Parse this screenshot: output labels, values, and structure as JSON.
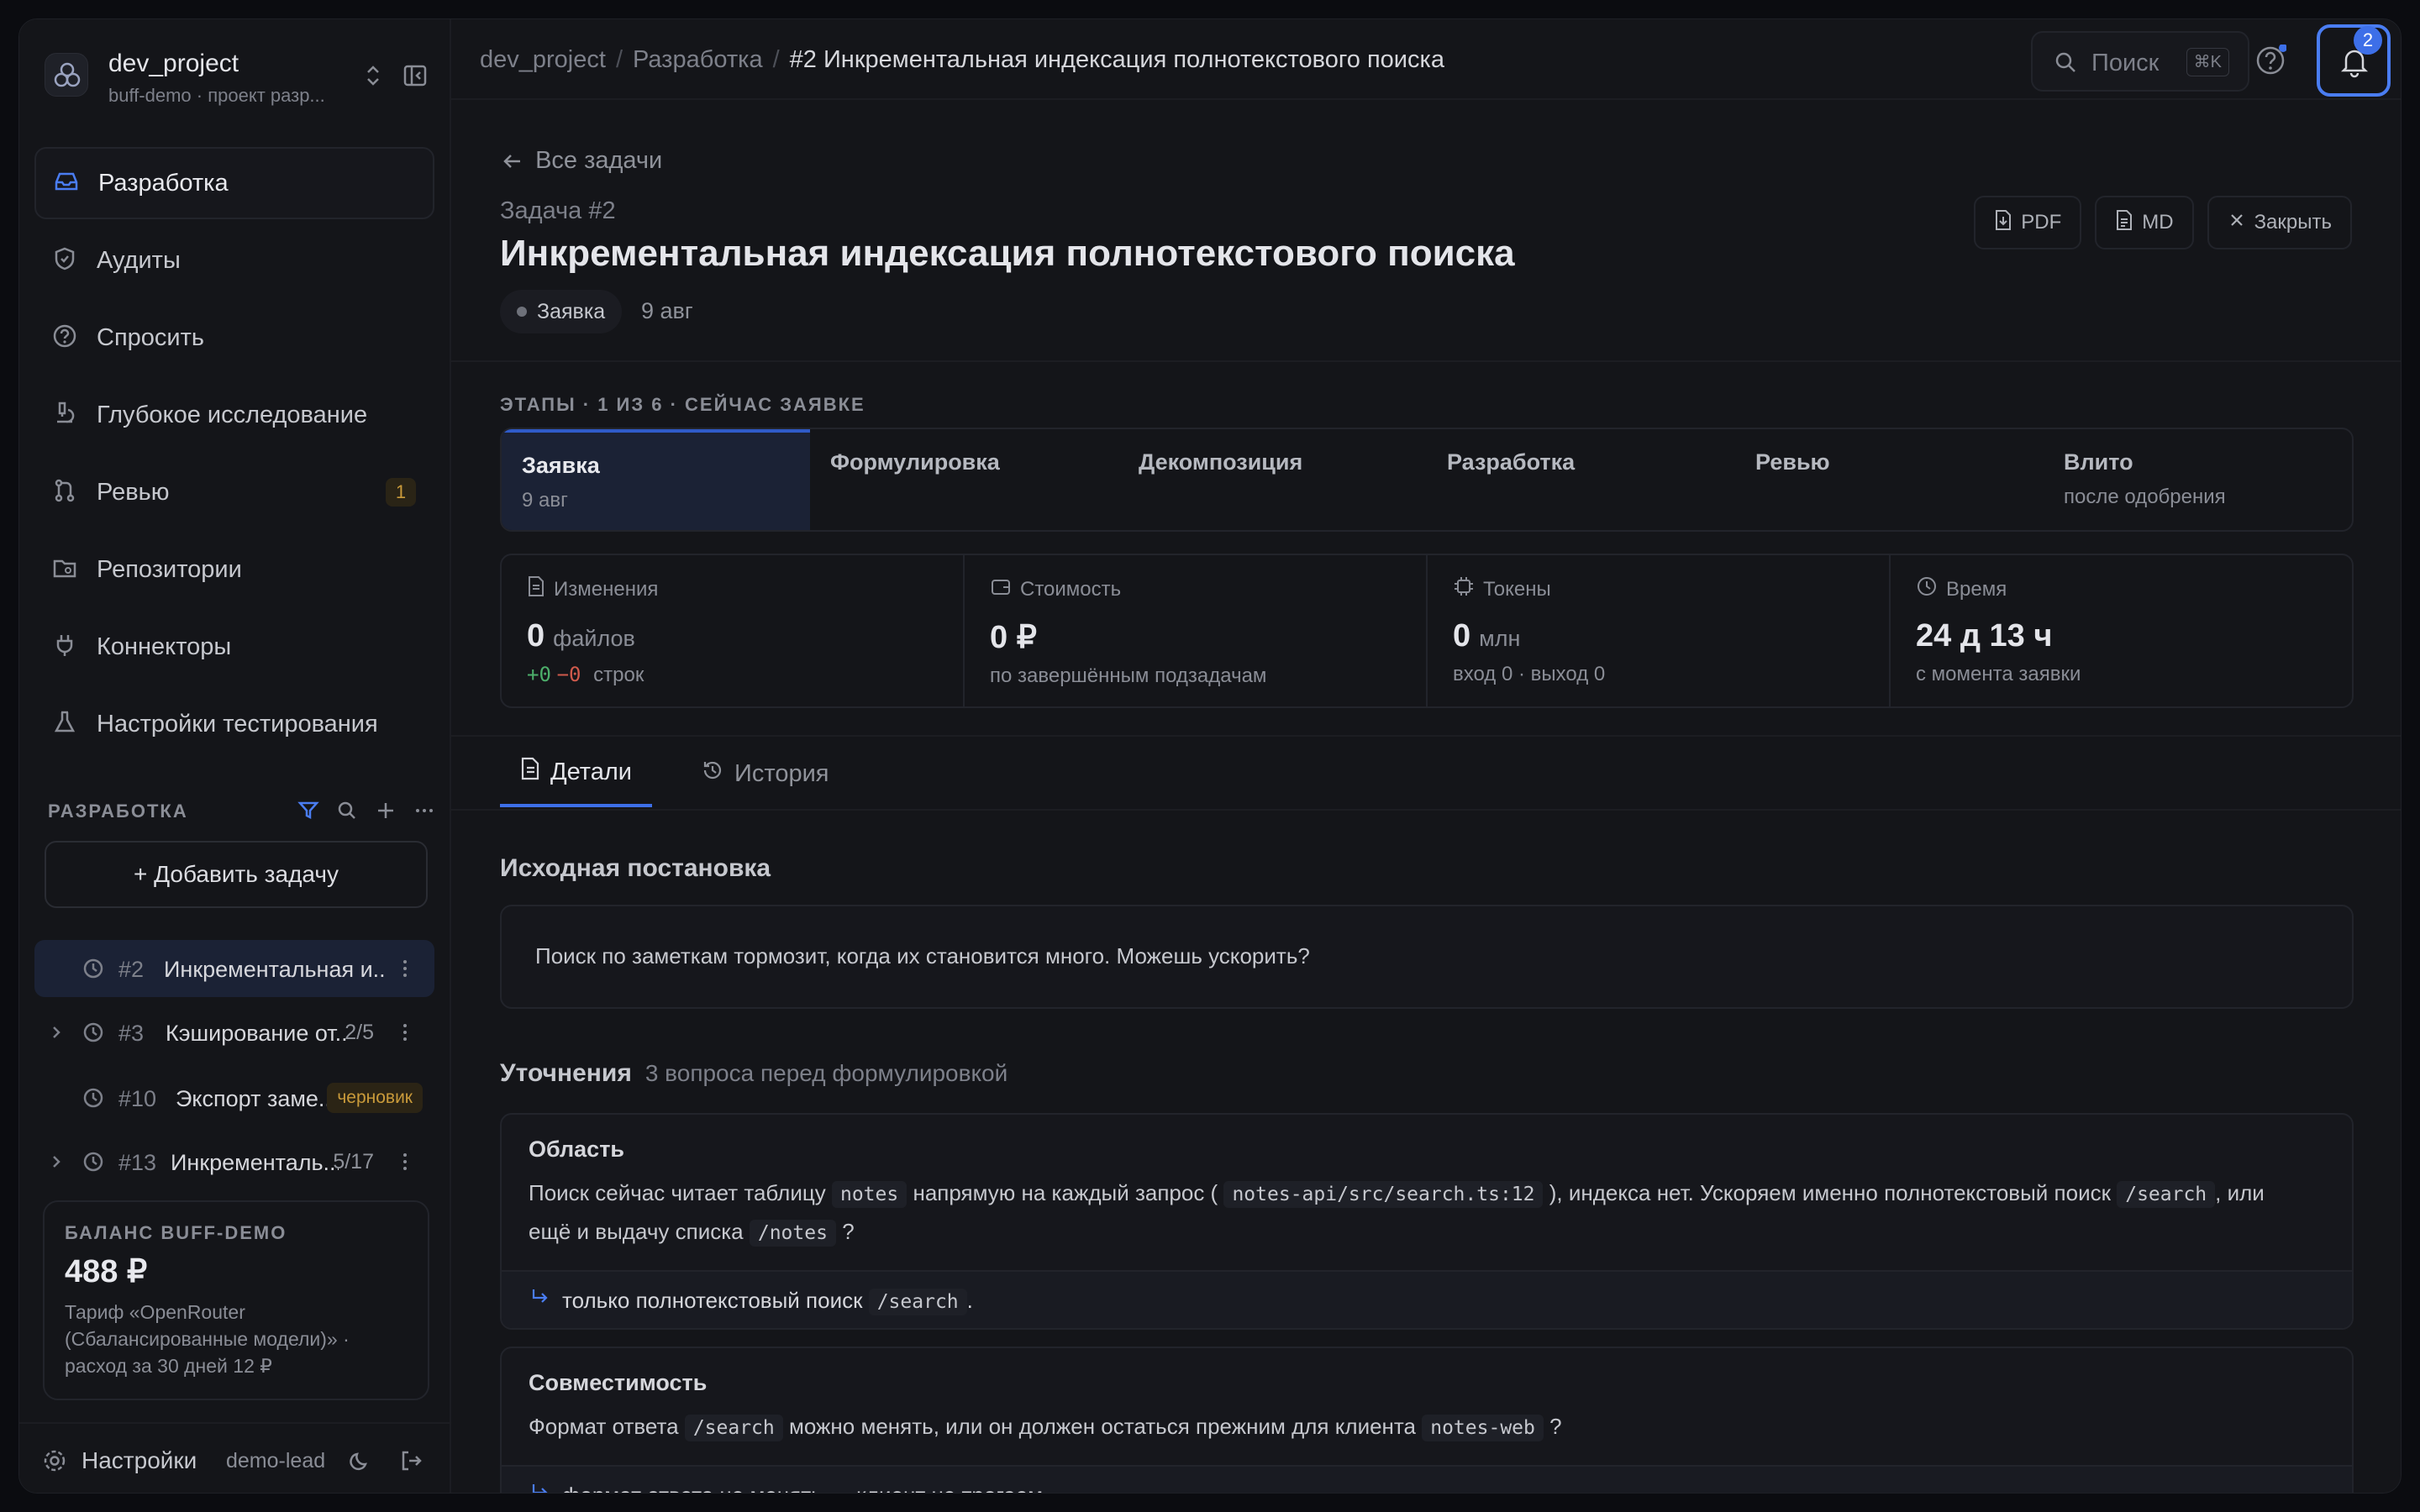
{
  "sidebar": {
    "project_name": "dev_project",
    "project_sub": "buff-demo · проект разр...",
    "nav": [
      {
        "label": "Разработка",
        "icon": "inbox-icon"
      },
      {
        "label": "Аудиты",
        "icon": "shield-icon"
      },
      {
        "label": "Спросить",
        "icon": "question-icon"
      },
      {
        "label": "Глубокое исследование",
        "icon": "flask-search-icon"
      },
      {
        "label": "Ревью",
        "icon": "git-merge-icon",
        "badge": "1"
      },
      {
        "label": "Репозитории",
        "icon": "folder-git-icon"
      },
      {
        "label": "Коннекторы",
        "icon": "plug-icon"
      },
      {
        "label": "Настройки тестирования",
        "icon": "beaker-icon"
      }
    ],
    "section_title": "РАЗРАБОТКА",
    "add_task": "+ Добавить задачу",
    "tasks": [
      {
        "num": "#2",
        "title": "Инкрементальная и...",
        "count": ""
      },
      {
        "num": "#3",
        "title": "Кэширование от...",
        "count": "2/5"
      },
      {
        "num": "#10",
        "title": "Экспорт заме...",
        "badge": "черновик"
      },
      {
        "num": "#13",
        "title": "Инкременталь...",
        "count": "5/17"
      }
    ],
    "balance": {
      "title": "БАЛАНС BUFF-DEMO",
      "value": "488 ₽",
      "desc1": "Тариф «OpenRouter",
      "desc2": "(Сбалансированные модели)» ·",
      "desc3": "расход за 30 дней 12 ₽"
    },
    "footer": {
      "settings": "Настройки",
      "user": "demo-lead"
    }
  },
  "topbar": {
    "crumbs": [
      "dev_project",
      "Разработка",
      "#2 Инкрементальная индексация полнотекстового поиска"
    ],
    "search_placeholder": "Поиск",
    "search_kbd": "⌘K",
    "notif_count": "2"
  },
  "task": {
    "back": "Все задачи",
    "label": "Задача  #2",
    "title": "Инкрементальная индексация полнотекстового поиска",
    "status": "Заявка",
    "date": "9 авг",
    "actions": {
      "pdf": "PDF",
      "md": "MD",
      "close": "Закрыть"
    }
  },
  "stages": {
    "header": "ЭТАПЫ · 1 ИЗ 6 · СЕЙЧАС ЗАЯВКЕ",
    "items": [
      {
        "name": "Заявка",
        "sub": "9 авг"
      },
      {
        "name": "Формулировка",
        "sub": ""
      },
      {
        "name": "Декомпозиция",
        "sub": ""
      },
      {
        "name": "Разработка",
        "sub": ""
      },
      {
        "name": "Ревью",
        "sub": ""
      },
      {
        "name": "Влито",
        "sub": "после одобрения"
      }
    ]
  },
  "stats": [
    {
      "label": "Изменения",
      "value": "0",
      "unit": "файлов",
      "plus": "+0",
      "minus": "−0",
      "foot": "строк"
    },
    {
      "label": "Стоимость",
      "value": "0 ₽",
      "unit": "",
      "foot": "по завершённым подзадачам"
    },
    {
      "label": "Токены",
      "value": "0",
      "unit": "млн",
      "foot": "вход 0 · выход 0"
    },
    {
      "label": "Время",
      "value": "24 д 13 ч",
      "unit": "",
      "foot": "с момента заявки"
    }
  ],
  "tabs": [
    {
      "label": "Детали"
    },
    {
      "label": "История"
    }
  ],
  "details": {
    "orig_title": "Исходная постановка",
    "orig_text": "Поиск по заметкам тормозит, когда их становится много. Можешь ускорить?",
    "clar_title": "Уточнения",
    "clar_note": "3 вопроса перед формулировкой",
    "q1": {
      "title": "Область",
      "t1": "Поиск сейчас читает таблицу",
      "c1": "notes",
      "t2": "напрямую на каждый запрос (",
      "c2": "notes-api/src/search.ts:12",
      "t3": "), индекса нет. Ускоряем именно полнотекстовый поиск",
      "c3": "/search",
      "t4": ", или",
      "t5": "ещё и выдачу списка",
      "c4": "/notes",
      "t6": "?",
      "answer": "только полнотекстовый поиск",
      "ac": "/search",
      "aend": "."
    },
    "q2": {
      "title": "Совместимость",
      "t1": "Формат ответа",
      "c1": "/search",
      "t2": "можно менять, или он должен остаться прежним для клиента",
      "c2": "notes-web",
      "t3": "?",
      "answer": "формат ответа не менять — клиент не трогаем."
    }
  }
}
